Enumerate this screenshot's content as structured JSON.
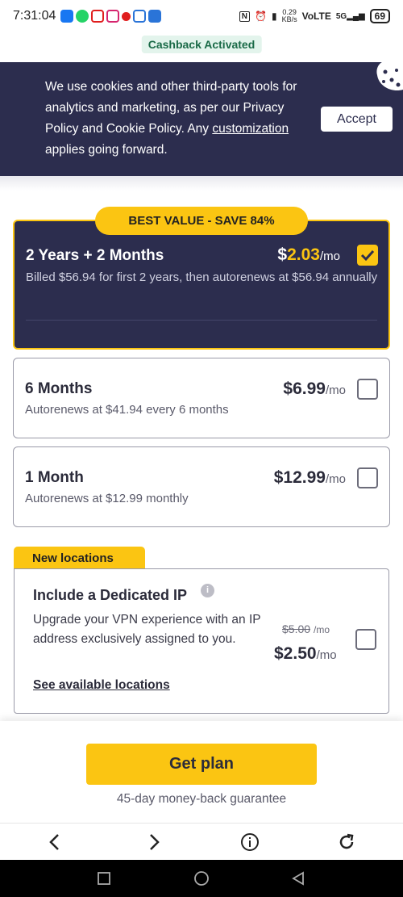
{
  "status_bar": {
    "time": "7:31:04",
    "network_speed": "0.29",
    "network_unit": "KB/s",
    "volte": "VoLTE",
    "signal": "5G",
    "battery": "69"
  },
  "cashback": "Cashback Activated",
  "cookie_banner": {
    "text_before": "We use cookies and other third-party tools for analytics and marketing, as per our Privacy Policy and Cookie Policy. Any ",
    "link": "customization",
    "text_after": " applies going forward.",
    "accept_label": "Accept"
  },
  "plans": [
    {
      "badge": "BEST VALUE - SAVE 84%",
      "title": "2 Years + 2 Months",
      "price_symbol": "$",
      "price_value": "2.03",
      "per": "/mo",
      "subtitle": "Billed $56.94 for first 2 years, then autorenews at $56.94 annually",
      "selected": true
    },
    {
      "title": "6 Months",
      "price": "$6.99",
      "per": "/mo",
      "subtitle": "Autorenews at $41.94 every 6 months",
      "selected": false
    },
    {
      "title": "1 Month",
      "price": "$12.99",
      "per": "/mo",
      "subtitle": "Autorenews at $12.99 monthly",
      "selected": false
    }
  ],
  "dedicated_ip": {
    "tab": "New locations",
    "title": "Include a Dedicated IP",
    "info": "i",
    "description": "Upgrade your VPN experience with an IP address exclusively assigned to you.",
    "old_price": "$5.00",
    "old_per": "/mo",
    "price": "$2.50",
    "per": "/mo",
    "link": "See available locations"
  },
  "cta": {
    "button": "Get plan",
    "guarantee": "45-day money-back guarantee"
  },
  "colors": {
    "accent_yellow": "#fbc512",
    "navy": "#2c2d4e"
  }
}
